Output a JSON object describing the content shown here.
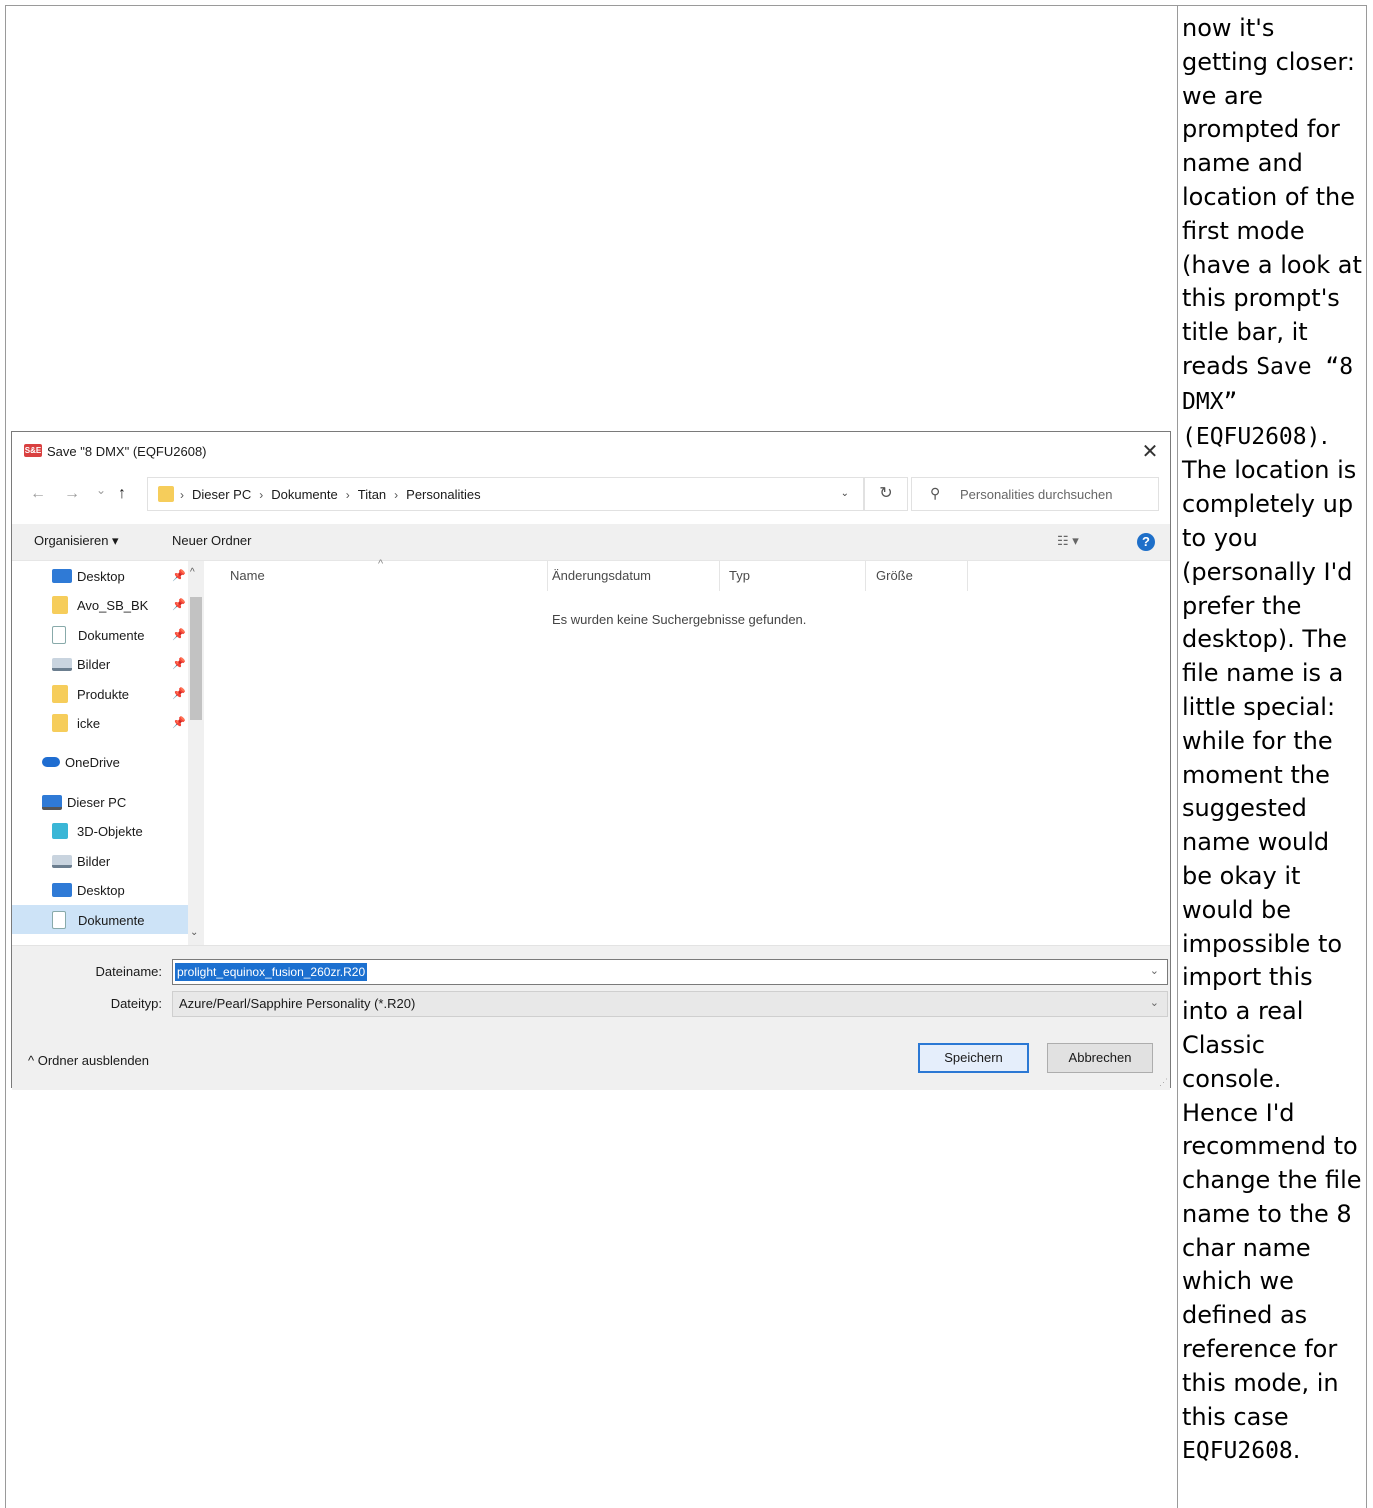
{
  "note": {
    "text_1": "now it's getting closer: we are prompted for name and location of the first mode (have a look at this prompt's title bar, it reads ",
    "code_1": "Save “8 DMX” (EQFU2608)",
    "text_2": ". The location is completely up to you (personally I'd prefer the desktop). The file name is a little special: while for the moment the suggested name would be okay it would be impossible to import this into a real Classic console. Hence I'd recommend to change the file name to the 8 char name which we defined as reference for this mode, in this case ",
    "code_2": "EQFU2608",
    "text_3": "."
  },
  "dialog": {
    "title": "Save \"8 DMX\" (EQFU2608)",
    "app_icon_text": "S&E",
    "close": "✕",
    "nav": {
      "back": "←",
      "forward": "→",
      "recent": "⌄",
      "up": "↑"
    },
    "breadcrumb": [
      "Dieser PC",
      "Dokumente",
      "Titan",
      "Personalities"
    ],
    "search_placeholder": "Personalities durchsuchen",
    "toolbar": {
      "organize": "Organisieren ▾",
      "new_folder": "Neuer Ordner",
      "view": "☷ ▾",
      "help": "?"
    },
    "sidebar": [
      {
        "label": "Desktop",
        "pinned": true
      },
      {
        "label": "Avo_SB_BK",
        "pinned": true
      },
      {
        "label": "Dokumente",
        "pinned": true
      },
      {
        "label": "Bilder",
        "pinned": true
      },
      {
        "label": "Produkte",
        "pinned": true
      },
      {
        "label": "icke",
        "pinned": true
      },
      {
        "label": "OneDrive"
      },
      {
        "label": "Dieser PC"
      },
      {
        "label": "3D-Objekte"
      },
      {
        "label": "Bilder"
      },
      {
        "label": "Desktop"
      },
      {
        "label": "Dokumente"
      }
    ],
    "columns": [
      "Name",
      "Änderungsdatum",
      "Typ",
      "Größe"
    ],
    "empty_message": "Es wurden keine Suchergebnisse gefunden.",
    "filename_label": "Dateiname:",
    "filename_value": "prolight_equinox_fusion_260zr.R20",
    "filetype_label": "Dateityp:",
    "filetype_value": "Azure/Pearl/Sapphire Personality (*.R20)",
    "hide_folders": "^  Ordner ausblenden",
    "save_button": "Speichern",
    "cancel_button": "Abbrechen"
  },
  "colors": {
    "accent": "#1c70d0",
    "selected_bg": "#cde3f7",
    "toolbar_bg": "#f0f0f0"
  }
}
